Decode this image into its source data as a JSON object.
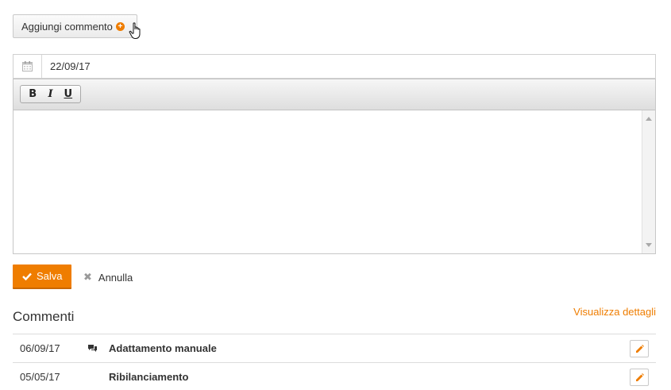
{
  "add_comment": {
    "label": "Aggiungi commento"
  },
  "date_field": {
    "value": "22/09/17"
  },
  "toolbar": {
    "bold": "B",
    "italic": "I",
    "underline": "U"
  },
  "actions": {
    "save_label": "Salva",
    "cancel_label": "Annulla"
  },
  "comments": {
    "title": "Commenti",
    "details_link": "Visualizza dettagli",
    "items": [
      {
        "date": "06/09/17",
        "title": "Adattamento manuale",
        "has_chat_icon": true
      },
      {
        "date": "05/05/17",
        "title": "Ribilanciamento",
        "has_chat_icon": false
      }
    ]
  },
  "colors": {
    "accent": "#ef7d00",
    "border": "#d0d0d0"
  }
}
